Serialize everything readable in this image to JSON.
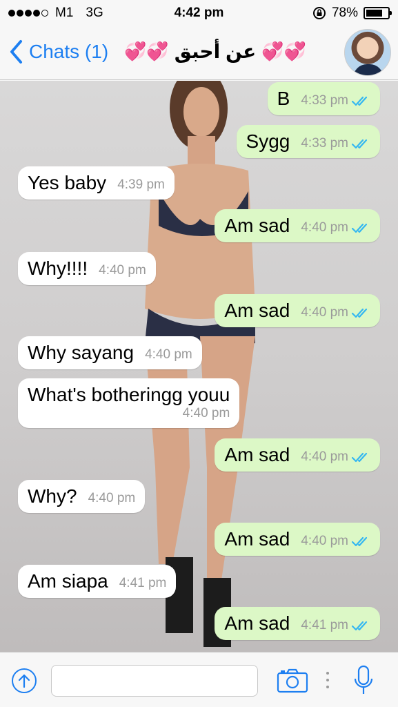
{
  "status_bar": {
    "carrier": "M1",
    "network": "3G",
    "time": "4:42 pm",
    "battery_percent": "78%",
    "battery_level": 0.78
  },
  "nav": {
    "back_label": "Chats (1)",
    "contact_name": "عن أحبق",
    "hearts_left": "💞💞",
    "hearts_right": "💞💞"
  },
  "messages": [
    {
      "dir": "out",
      "text": "B",
      "time": "4:33 pm"
    },
    {
      "dir": "out",
      "text": "Sygg",
      "time": "4:33 pm"
    },
    {
      "dir": "in",
      "text": "Yes baby",
      "time": "4:39 pm"
    },
    {
      "dir": "out",
      "text": "Am sad",
      "time": "4:40 pm"
    },
    {
      "dir": "in",
      "text": "Why!!!!",
      "time": "4:40 pm"
    },
    {
      "dir": "out",
      "text": "Am sad",
      "time": "4:40 pm"
    },
    {
      "dir": "in",
      "text": "Why sayang",
      "time": "4:40 pm"
    },
    {
      "dir": "in",
      "text": "What's botheringg youu",
      "time": "4:40 pm"
    },
    {
      "dir": "out",
      "text": "Am sad",
      "time": "4:40 pm"
    },
    {
      "dir": "in",
      "text": "Why?",
      "time": "4:40 pm"
    },
    {
      "dir": "out",
      "text": "Am sad",
      "time": "4:40 pm"
    },
    {
      "dir": "in",
      "text": "Am siapa",
      "time": "4:41 pm"
    },
    {
      "dir": "out",
      "text": "Am sad",
      "time": "4:41 pm"
    }
  ],
  "input": {
    "placeholder": ""
  },
  "colors": {
    "accent": "#1d7ff1",
    "outgoing_bubble": "#dcf8c6",
    "incoming_bubble": "#ffffff",
    "read_ticks": "#34b7f1"
  },
  "icons": {
    "back": "chevron-left-icon",
    "share": "share-up-icon",
    "camera": "camera-icon",
    "mic": "microphone-icon",
    "read_receipt": "double-check-icon"
  }
}
